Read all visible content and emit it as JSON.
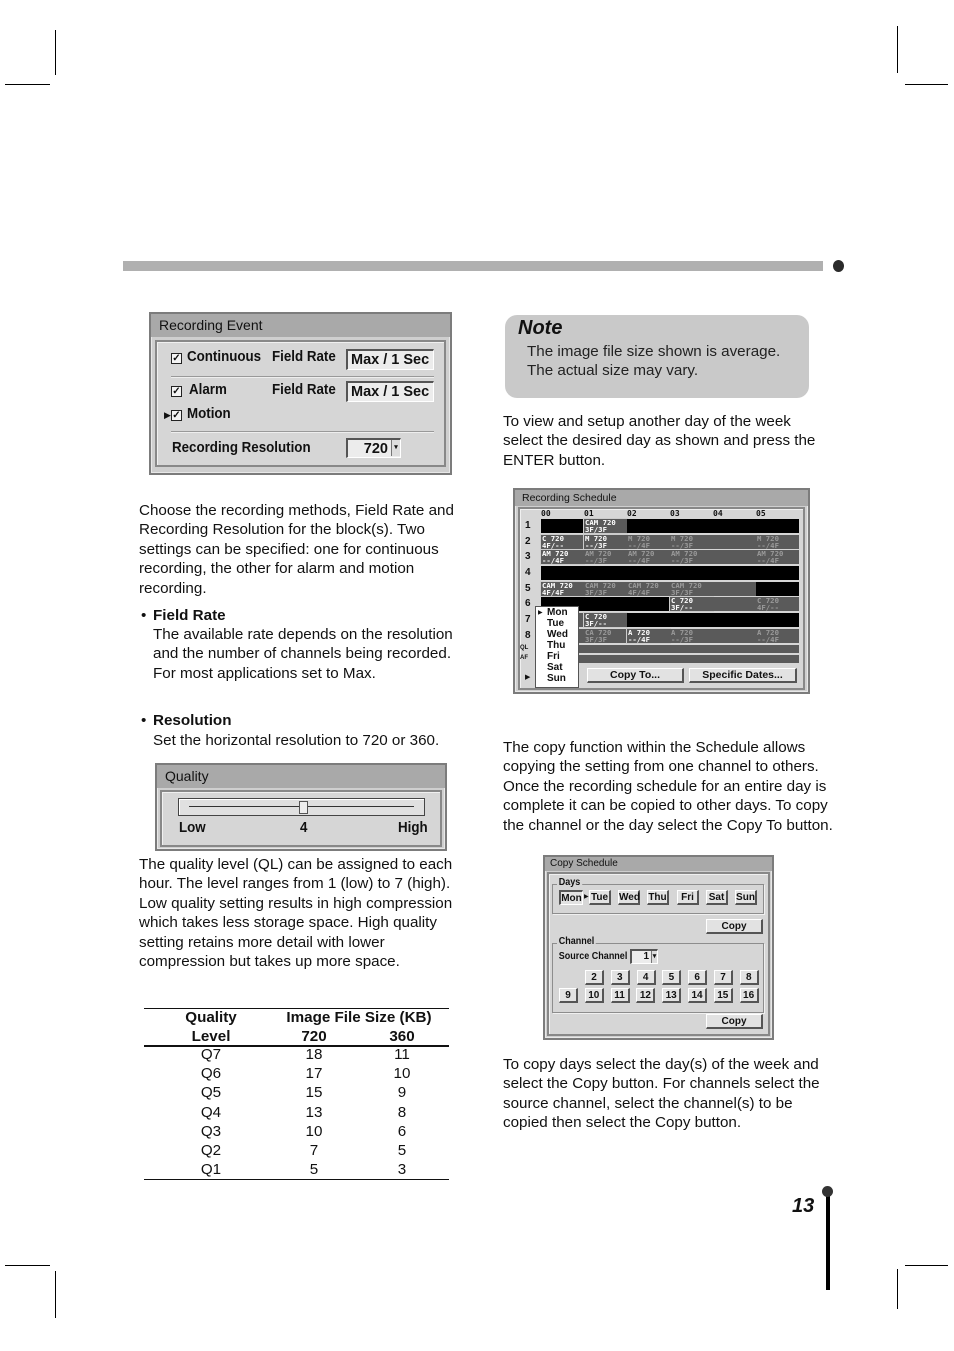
{
  "recording_event": {
    "title": "Recording Event",
    "continuous_label": "Continuous",
    "continuous_checked": true,
    "alarm_label": "Alarm",
    "alarm_checked": true,
    "motion_label": "Motion",
    "motion_checked": true,
    "field_rate_label": "Field Rate",
    "continuous_field_rate": "Max / 1 Sec",
    "alarm_field_rate": "Max / 1 Sec",
    "resolution_label": "Recording Resolution",
    "resolution_value": "720"
  },
  "left_text": {
    "intro": "Choose the recording methods, Field Rate and Recording Resolution for the block(s). Two settings can be specified: one for continuous recording, the other for alarm and motion recording.",
    "bullets": [
      {
        "title": "Field Rate",
        "body": "The available rate depends on the resolution and the number of channels being recorded. For most applications set to Max."
      },
      {
        "title": "Resolution",
        "body": "Set the horizontal resolution to 720 or 360."
      }
    ],
    "quality_text": "The quality level (QL) can be assigned to each hour. The level ranges from 1 (low) to 7 (high). Low quality setting results in high compression which takes less storage space. High quality setting retains more detail with lower compression but takes up more space."
  },
  "quality_panel": {
    "title": "Quality",
    "low_label": "Low",
    "high_label": "High",
    "value": "4",
    "min": 1,
    "max": 7,
    "current": 4
  },
  "quality_table": {
    "header_col1": [
      "Quality",
      "Level"
    ],
    "header_group": "Image File Size (KB)",
    "header_720": "720",
    "header_360": "360",
    "rows": [
      {
        "level": "Q7",
        "r720": "18",
        "r360": "11"
      },
      {
        "level": "Q6",
        "r720": "17",
        "r360": "10"
      },
      {
        "level": "Q5",
        "r720": "15",
        "r360": "9"
      },
      {
        "level": "Q4",
        "r720": "13",
        "r360": "8"
      },
      {
        "level": "Q3",
        "r720": "10",
        "r360": "6"
      },
      {
        "level": "Q2",
        "r720": "7",
        "r360": "5"
      },
      {
        "level": "Q1",
        "r720": "5",
        "r360": "3"
      }
    ]
  },
  "note": {
    "title": "Note",
    "line1": "The image file size shown is average.",
    "line2": "The actual size may vary."
  },
  "right_text": {
    "view_day": "To view and setup another day of the week select the desired day as shown and press the ENTER button.",
    "copy_intro": "The copy function within the Schedule allows copying the setting from one channel to others. Once the recording schedule for an entire day is complete it can be copied to other days. To copy the channel or the day select the Copy To button.",
    "copy_howto": "To copy days select the day(s) of the week and select the Copy button. For channels select the source channel, select the channel(s) to be copied then select the Copy button."
  },
  "schedule": {
    "title": "Recording Schedule",
    "hours": [
      "00",
      "01",
      "02",
      "03",
      "04",
      "05"
    ],
    "row_labels": [
      "1",
      "2",
      "3",
      "4",
      "5",
      "6",
      "7",
      "8",
      "QL",
      "AF"
    ],
    "rows": [
      [
        {
          "t": "",
          "s": "off"
        },
        {
          "t": "CAM 720\n3F/3F",
          "s": "on"
        },
        {
          "t": "",
          "s": "off"
        },
        {
          "t": "",
          "s": "off"
        },
        {
          "t": "",
          "s": "off"
        },
        {
          "t": "",
          "s": "off"
        }
      ],
      [
        {
          "t": "C 720\n4F/--",
          "s": "on"
        },
        {
          "t": "M 720\n--/3F",
          "s": "on"
        },
        {
          "t": "M 720\n--/4F",
          "s": "dim"
        },
        {
          "t": "M 720\n--/3F",
          "s": "dim"
        },
        {
          "t": "",
          "s": "gray"
        },
        {
          "t": "M 720\n--/4F",
          "s": "dim"
        }
      ],
      [
        {
          "t": "AM 720\n--/4F",
          "s": "on"
        },
        {
          "t": "AM 720\n--/3F",
          "s": "dim"
        },
        {
          "t": "AM 720\n--/4F",
          "s": "dim"
        },
        {
          "t": "AM 720\n--/3F",
          "s": "dim"
        },
        {
          "t": "",
          "s": "gray"
        },
        {
          "t": "AM 720\n--/4F",
          "s": "dim"
        }
      ],
      [
        {
          "t": "",
          "s": "off"
        },
        {
          "t": "",
          "s": "off"
        },
        {
          "t": "",
          "s": "off"
        },
        {
          "t": "",
          "s": "off"
        },
        {
          "t": "",
          "s": "off"
        },
        {
          "t": "",
          "s": "off"
        }
      ],
      [
        {
          "t": "CAM 720\n4F/4F",
          "s": "on"
        },
        {
          "t": "CAM 720\n3F/3F",
          "s": "dim"
        },
        {
          "t": "CAM 720\n4F/4F",
          "s": "dim"
        },
        {
          "t": "CAM 720\n3F/3F",
          "s": "dim"
        },
        {
          "t": "",
          "s": "gray"
        },
        {
          "t": "",
          "s": "off"
        }
      ],
      [
        {
          "t": "",
          "s": "off"
        },
        {
          "t": "",
          "s": "off"
        },
        {
          "t": "",
          "s": "off"
        },
        {
          "t": "C 720\n3F/--",
          "s": "on"
        },
        {
          "t": "",
          "s": "gray"
        },
        {
          "t": "C 720\n4F/--",
          "s": "dim"
        }
      ],
      [
        {
          "t": "",
          "s": "gray"
        },
        {
          "t": "C 720\n3F/--",
          "s": "on"
        },
        {
          "t": "",
          "s": "off"
        },
        {
          "t": "",
          "s": "off"
        },
        {
          "t": "",
          "s": "off"
        },
        {
          "t": "",
          "s": "off"
        }
      ],
      [
        {
          "t": "",
          "s": "gray"
        },
        {
          "t": "CA 720\n3F/3F",
          "s": "dim"
        },
        {
          "t": "A 720\n--/4F",
          "s": "on"
        },
        {
          "t": "A 720\n--/3F",
          "s": "dim"
        },
        {
          "t": "",
          "s": "gray"
        },
        {
          "t": "A 720\n--/4F",
          "s": "dim"
        }
      ],
      [
        {
          "t": "",
          "s": "gray"
        },
        {
          "t": "",
          "s": "gray"
        },
        {
          "t": "",
          "s": "gray"
        },
        {
          "t": "",
          "s": "gray"
        },
        {
          "t": "",
          "s": "gray"
        },
        {
          "t": "",
          "s": "gray"
        }
      ],
      [
        {
          "t": "",
          "s": "gray"
        },
        {
          "t": "",
          "s": "gray"
        },
        {
          "t": "",
          "s": "gray"
        },
        {
          "t": "",
          "s": "gray"
        },
        {
          "t": "",
          "s": "gray"
        },
        {
          "t": "",
          "s": "gray"
        }
      ]
    ],
    "days": [
      "Mon",
      "Tue",
      "Wed",
      "Thu",
      "Fri",
      "Sat",
      "Sun"
    ],
    "selected_day": "Mon",
    "copy_to_label": "Copy To...",
    "specific_dates_label": "Specific Dates..."
  },
  "copy_schedule": {
    "title": "Copy Schedule",
    "days_group": "Days",
    "days": [
      "Mon",
      "Tue",
      "Wed",
      "Thu",
      "Fri",
      "Sat",
      "Sun"
    ],
    "copy_label": "Copy",
    "channel_group": "Channel",
    "source_channel_label": "Source Channel",
    "source_channel_value": "1",
    "channels_row1": [
      "2",
      "3",
      "4",
      "5",
      "6",
      "7",
      "8"
    ],
    "channels_row2": [
      "9",
      "10",
      "11",
      "12",
      "13",
      "14",
      "15",
      "16"
    ]
  },
  "page_number": "13",
  "colors": {
    "panel_bg": "#cfcfcf",
    "panel_title": "#a9a9a9",
    "cell_on": "#5a5a5a",
    "cell_off": "#000000",
    "header_bar": "#b0b0b0"
  }
}
